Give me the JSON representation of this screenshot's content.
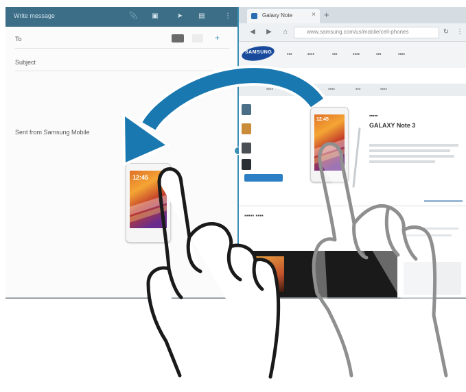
{
  "email_app": {
    "title": "Write message",
    "to_label": "To",
    "subject_placeholder": "Subject",
    "signature": "Sent from Samsung Mobile"
  },
  "browser": {
    "tab_title": "Galaxy Note",
    "url": "www.samsung.com/us/mobile/cell-phones",
    "page": {
      "brand": "SAMSUNG",
      "product_title": "GALAXY Note 3",
      "clock": "12:45"
    }
  },
  "dragged_item": {
    "clock": "12:45"
  },
  "gesture": {
    "arrow_color": "#1a78b0",
    "divider_color": "#3a8fb5"
  },
  "icons": [
    "attach-icon",
    "camera-icon",
    "send-icon",
    "more-icon",
    "add-recipient-icon",
    "back-icon",
    "forward-icon",
    "home-icon",
    "refresh-icon",
    "menu-icon",
    "new-tab-icon"
  ]
}
